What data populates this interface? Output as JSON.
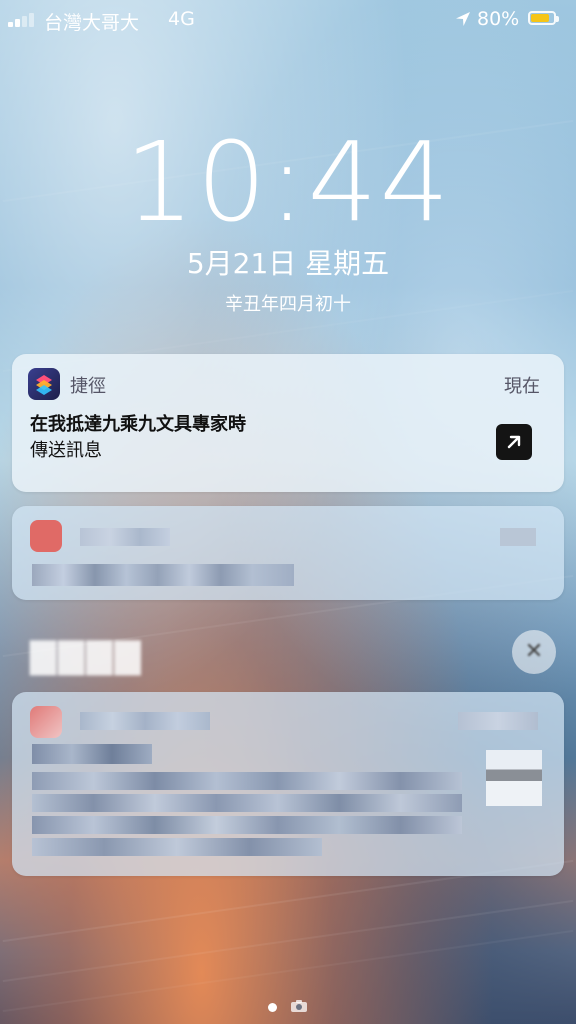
{
  "status": {
    "carrier": "台灣大哥大",
    "network": "4G",
    "battery_percent": "80%",
    "battery_level": 0.8
  },
  "lock": {
    "time": "10:44",
    "date": "5月21日 星期五",
    "lunar_date": "辛丑年四月初十"
  },
  "notifications": [
    {
      "app": "捷徑",
      "time": "現在",
      "title": "在我抵達九乘九文具專家時",
      "body": "傳送訊息",
      "icon": "shortcuts-icon"
    }
  ],
  "colors": {
    "battery": "#f5c518",
    "shortcut_button": "#141414"
  }
}
